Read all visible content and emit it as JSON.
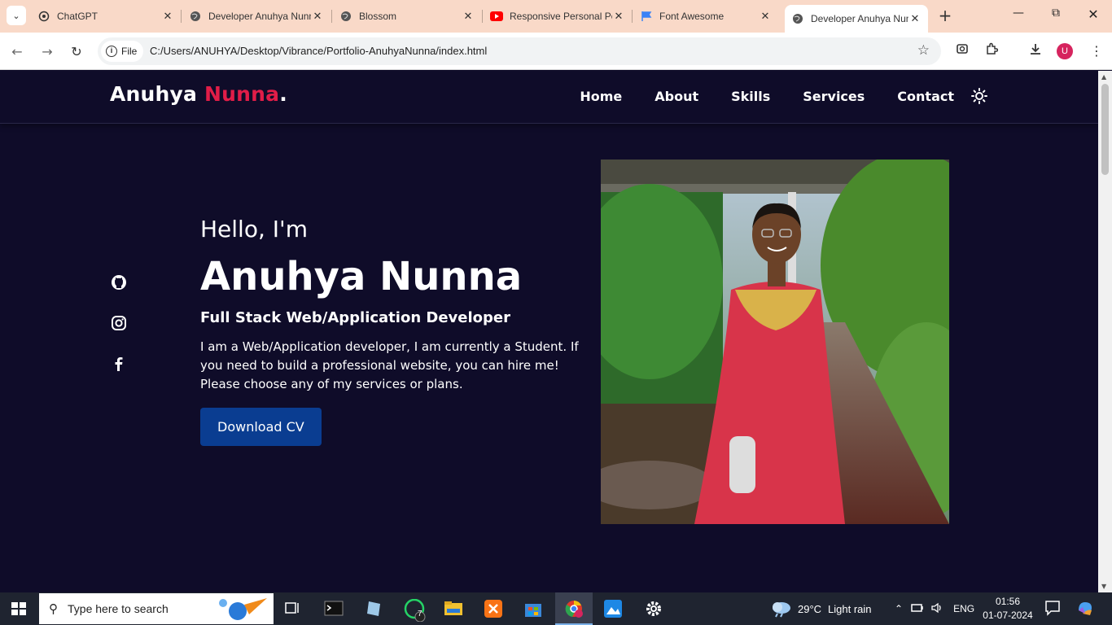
{
  "browser": {
    "tabs": [
      {
        "title": "ChatGPT",
        "icon": "chatgpt-icon"
      },
      {
        "title": "Developer Anuhya Nunna",
        "icon": "globe-icon"
      },
      {
        "title": "Blossom",
        "icon": "globe-icon"
      },
      {
        "title": "Responsive Personal Portfolio",
        "icon": "youtube-icon"
      },
      {
        "title": "Font Awesome",
        "icon": "flag-icon"
      },
      {
        "title": "Developer Anuhya Nunna",
        "icon": "globe-icon",
        "active": true
      }
    ],
    "file_chip": "File",
    "url": "C:/Users/ANUHYA/Desktop/Vibrance/Portfolio-AnuhyaNunna/index.html",
    "profile_initial": "U"
  },
  "page": {
    "logo_first": "Anuhya",
    "logo_last": "Nunna",
    "logo_dot": ".",
    "nav": [
      "Home",
      "About",
      "Skills",
      "Services",
      "Contact"
    ],
    "hero": {
      "greeting": "Hello, I'm",
      "name": "Anuhya Nunna",
      "role": "Full Stack Web/Application Developer",
      "description": "I am a Web/Application developer, I am currently a Student. If you need to build a professional website, you can hire me! Please choose any of my services or plans.",
      "cta": "Download CV"
    },
    "socials": [
      "github-icon",
      "instagram-icon",
      "facebook-icon"
    ],
    "colors": {
      "background": "#0f0c29",
      "accent": "#e11d48",
      "button": "#0a3d91"
    }
  },
  "taskbar": {
    "search_placeholder": "Type here to search",
    "whatsapp_badge": "7",
    "weather": {
      "temp": "29°C",
      "condition": "Light rain"
    },
    "language": "ENG",
    "time": "01:56",
    "date": "01-07-2024"
  }
}
